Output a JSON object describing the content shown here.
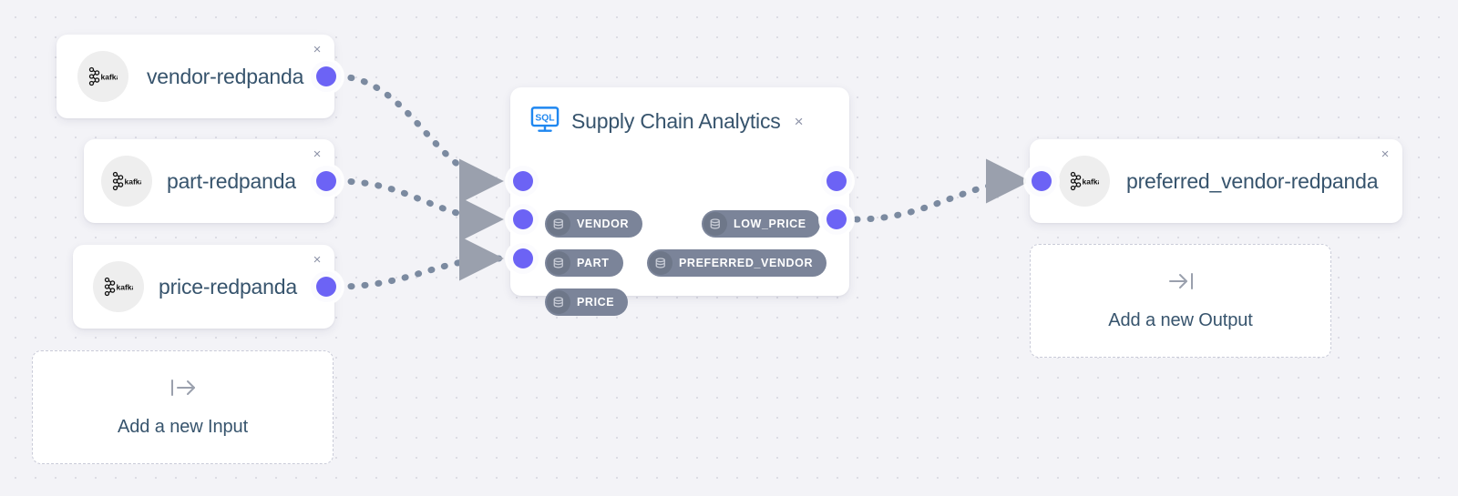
{
  "canvas": {
    "background_color": "#f3f3f7",
    "dot_color": "#dcdce4",
    "accent_port_color": "#6c63f5",
    "edge_color": "#7b8aa0",
    "pill_color": "#7b8499",
    "title_color": "#37546d"
  },
  "inputs": [
    {
      "name": "vendor-redpanda",
      "icon": "kafka-icon",
      "close_label": "×"
    },
    {
      "name": "part-redpanda",
      "icon": "kafka-icon",
      "close_label": "×"
    },
    {
      "name": "price-redpanda",
      "icon": "kafka-icon",
      "close_label": "×"
    }
  ],
  "processor": {
    "title": "Supply Chain Analytics",
    "icon": "sql-monitor-icon",
    "icon_label": "SQL",
    "close_label": "×",
    "input_streams": [
      {
        "label": "VENDOR",
        "icon": "database-icon"
      },
      {
        "label": "PART",
        "icon": "database-icon"
      },
      {
        "label": "PRICE",
        "icon": "database-icon"
      }
    ],
    "output_streams": [
      {
        "label": "LOW_PRICE",
        "icon": "database-icon"
      },
      {
        "label": "PREFERRED_VENDOR",
        "icon": "database-icon"
      }
    ]
  },
  "outputs": [
    {
      "name": "preferred_vendor-redpanda",
      "icon": "kafka-icon",
      "close_label": "×"
    }
  ],
  "placeholders": {
    "add_input": {
      "label": "Add a new Input",
      "icon": "arrow-out-icon"
    },
    "add_output": {
      "label": "Add a new Output",
      "icon": "arrow-in-icon"
    }
  }
}
